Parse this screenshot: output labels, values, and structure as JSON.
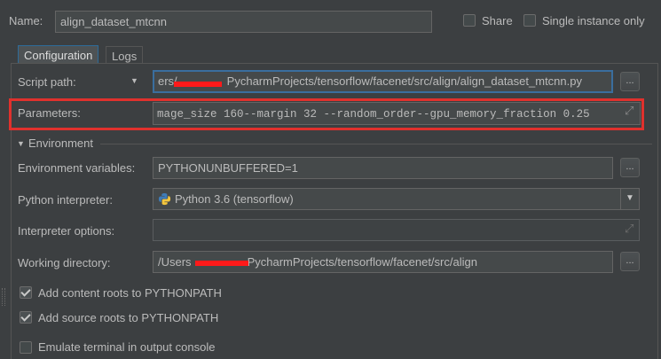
{
  "header": {
    "name_label": "Name:",
    "name_value": "align_dataset_mtcnn",
    "share_label": "Share",
    "single_instance_label": "Single instance only"
  },
  "tabs": [
    {
      "label": "Configuration",
      "active": true
    },
    {
      "label": "Logs",
      "active": false
    }
  ],
  "config": {
    "script_path_label": "Script path:",
    "script_path_value_start": "ers/",
    "script_path_value_end": "PycharmProjects/tensorflow/facenet/src/align/align_dataset_mtcnn.py",
    "parameters_label": "Parameters:",
    "parameters_value": "mage_size 160--margin 32 --random_order--gpu_memory_fraction 0.25",
    "environment_label": "Environment",
    "env_vars_label": "Environment variables:",
    "env_vars_value": "PYTHONUNBUFFERED=1",
    "interpreter_label": "Python interpreter:",
    "interpreter_value": "Python 3.6 (tensorflow)",
    "interpreter_options_label": "Interpreter options:",
    "interpreter_options_value": "",
    "working_dir_label": "Working directory:",
    "working_dir_value_start": "/Users",
    "working_dir_value_end": "PycharmProjects/tensorflow/facenet/src/align",
    "content_roots_label": "Add content roots to PYTHONPATH",
    "source_roots_label": "Add source roots to PYTHONPATH",
    "emulate_terminal_label": "Emulate terminal in output console",
    "browse_label": "..."
  },
  "checkboxes": {
    "share": false,
    "single_instance": false,
    "content_roots": true,
    "source_roots": true,
    "emulate_terminal": false
  },
  "colors": {
    "background": "#3c3f41",
    "field_background": "#45494a",
    "highlight_border": "#e0312d",
    "redaction": "#ff1a1a",
    "tab_active_border": "#2d6b99"
  },
  "icons": {
    "python": "python-logo-icon",
    "expand": "expand-diagonal-icon",
    "dropdown": "triangle-down-icon"
  }
}
